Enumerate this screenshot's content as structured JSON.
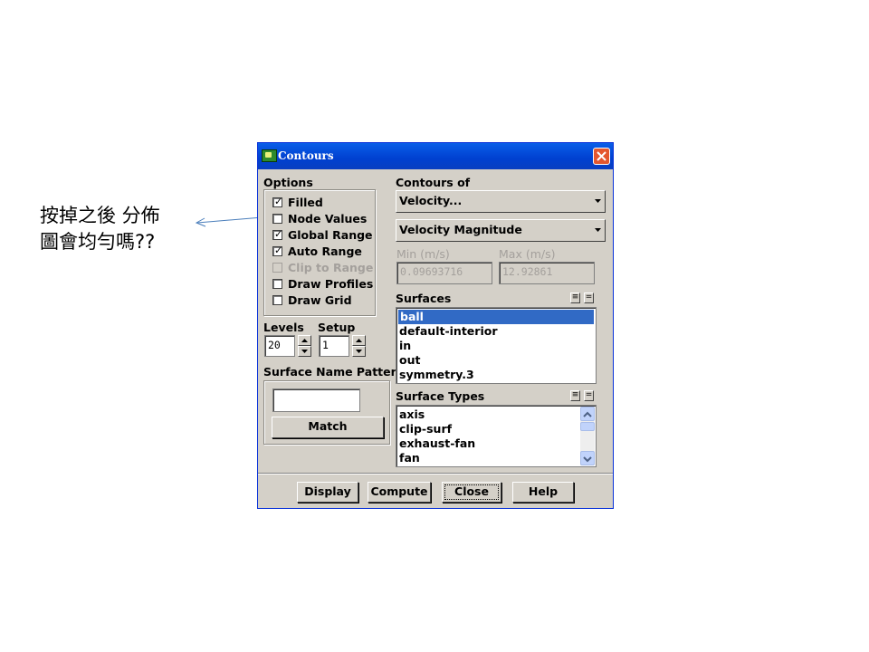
{
  "annotation": {
    "line1": "按掉之後 分佈",
    "line2": "圖會均勻嗎??"
  },
  "window": {
    "title": "Contours"
  },
  "options": {
    "title": "Options",
    "checkboxes": [
      {
        "label": "Filled",
        "checked": true,
        "disabled": false
      },
      {
        "label": "Node Values",
        "checked": false,
        "disabled": false
      },
      {
        "label": "Global Range",
        "checked": true,
        "disabled": false
      },
      {
        "label": "Auto Range",
        "checked": true,
        "disabled": false
      },
      {
        "label": "Clip to Range",
        "checked": false,
        "disabled": true
      },
      {
        "label": "Draw Profiles",
        "checked": false,
        "disabled": false
      },
      {
        "label": "Draw Grid",
        "checked": false,
        "disabled": false
      }
    ]
  },
  "levels": {
    "label": "Levels",
    "value": "20"
  },
  "setup": {
    "label": "Setup",
    "value": "1"
  },
  "surface_name_pattern": {
    "label": "Surface Name Pattern",
    "value": "",
    "match_label": "Match"
  },
  "contours_of": {
    "label": "Contours of",
    "field": "Velocity...",
    "sub_field": "Velocity Magnitude"
  },
  "range": {
    "min_label": "Min (m/s)",
    "max_label": "Max (m/s)",
    "min_value": "0.09693716",
    "max_value": "12.92861"
  },
  "surfaces": {
    "label": "Surfaces",
    "items": [
      "ball",
      "default-interior",
      "in",
      "out",
      "symmetry.3"
    ],
    "selected": "ball"
  },
  "surface_types": {
    "label": "Surface Types",
    "items": [
      "axis",
      "clip-surf",
      "exhaust-fan",
      "fan"
    ]
  },
  "buttons": {
    "display": "Display",
    "compute": "Compute",
    "close": "Close",
    "help": "Help"
  }
}
